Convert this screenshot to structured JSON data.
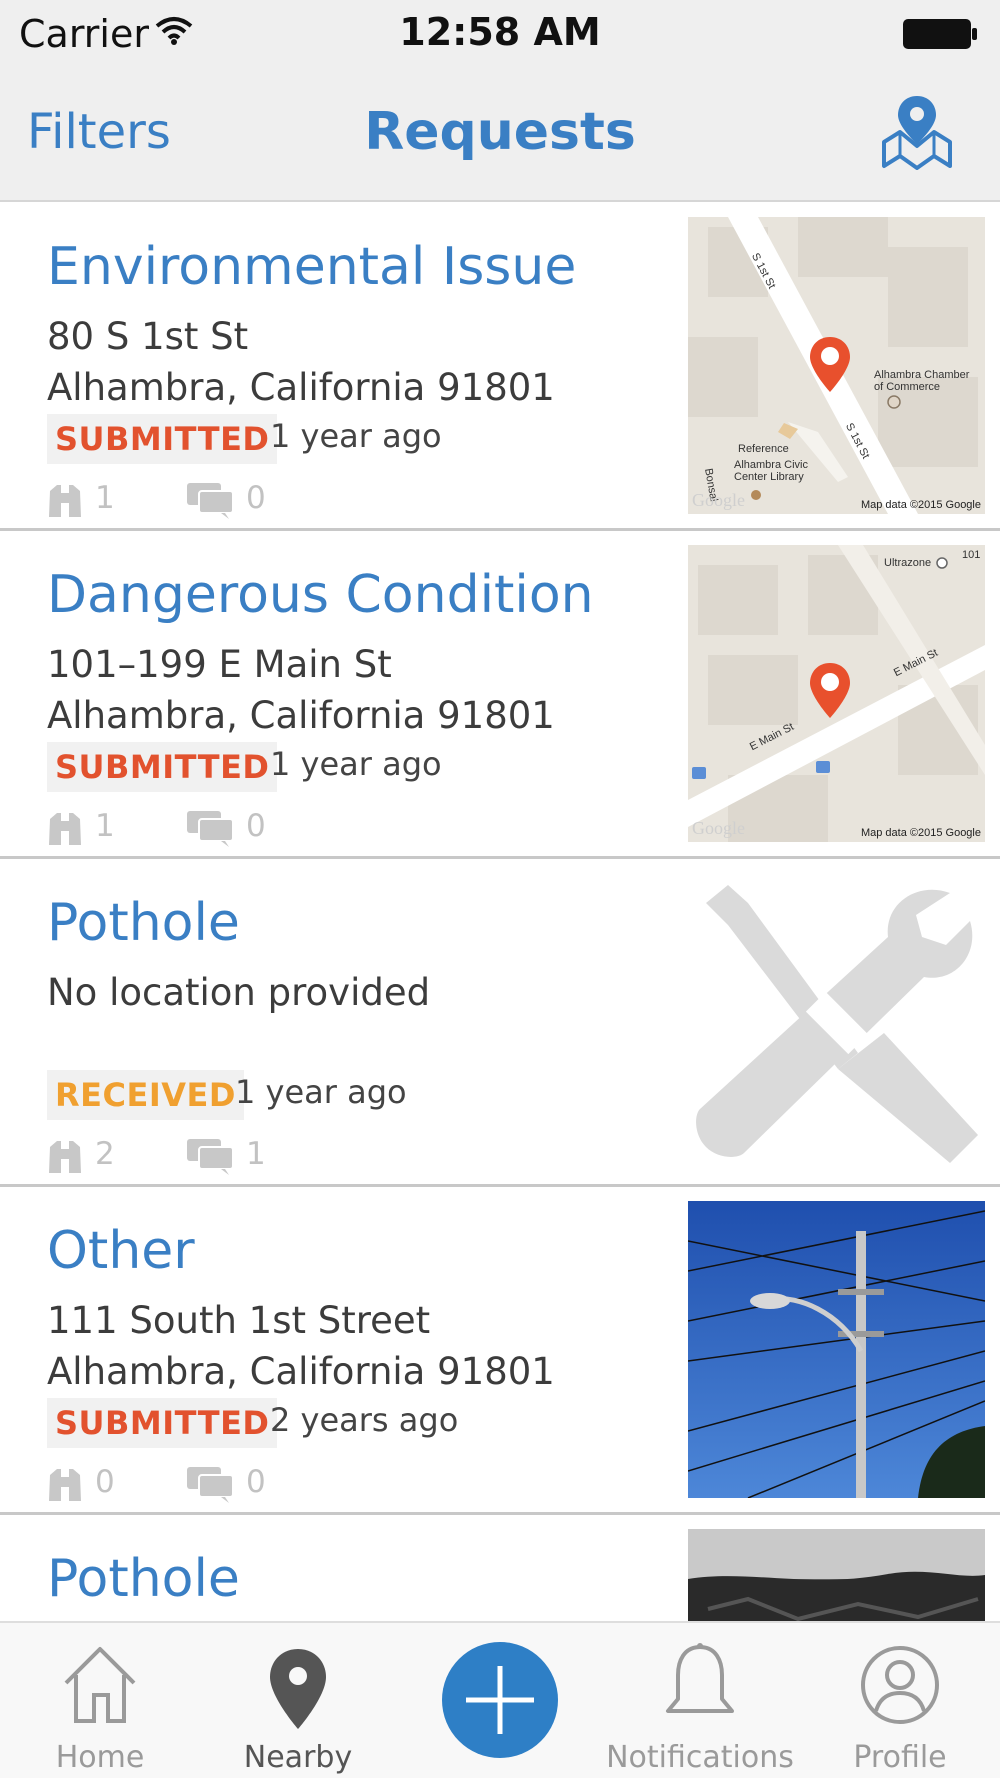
{
  "status_bar": {
    "carrier": "Carrier",
    "time": "12:58 AM"
  },
  "nav": {
    "left": "Filters",
    "title": "Requests",
    "map_icon": "map-pin-icon"
  },
  "requests": [
    {
      "title": "Environmental Issue",
      "line1": "80  S 1st St",
      "line2": "Alhambra, California 91801",
      "status": "SUBMITTED",
      "status_color": "#e2522e",
      "age": "1 year ago",
      "followers": "1",
      "comments": "0",
      "thumb": "map",
      "map": {
        "streets": [
          "S 1st St",
          "S 1st St"
        ],
        "labels": [
          "Alhambra Chamber",
          "of Commerce",
          "Reference",
          "Alhambra Civic",
          "Center Library",
          "Bonsal"
        ],
        "logo": "Google",
        "credit": "Map data ©2015 Google"
      }
    },
    {
      "title": "Dangerous Condition",
      "line1": "101–199  E Main St",
      "line2": "Alhambra, California 91801",
      "status": "SUBMITTED",
      "status_color": "#e2522e",
      "age": "1 year ago",
      "followers": "1",
      "comments": "0",
      "thumb": "map",
      "map": {
        "streets": [
          "E Main St",
          "E Main St"
        ],
        "labels": [
          "Ultrazone",
          "101"
        ],
        "logo": "Google",
        "credit": "Map data ©2015 Google"
      }
    },
    {
      "title": "Pothole",
      "line1": "No location provided",
      "line2": "",
      "status": "RECEIVED",
      "status_color": "#f0a030",
      "age": "1 year ago",
      "followers": "2",
      "comments": "1",
      "thumb": "tools-placeholder"
    },
    {
      "title": "Other",
      "line1": "111  South 1st Street",
      "line2": "Alhambra, California 91801",
      "status": "SUBMITTED",
      "status_color": "#e2522e",
      "age": "2 years ago",
      "followers": "0",
      "comments": "0",
      "thumb": "photo-streetlight"
    },
    {
      "title": "Pothole",
      "thumb": "photo-asphalt"
    }
  ],
  "tabs": [
    {
      "label": "Home",
      "icon": "home-icon"
    },
    {
      "label": "Nearby",
      "icon": "location-pin-icon",
      "active": true
    },
    {
      "label": "",
      "icon": "plus-icon"
    },
    {
      "label": "Notifications",
      "icon": "bell-icon"
    },
    {
      "label": "Profile",
      "icon": "user-icon"
    }
  ],
  "colors": {
    "accent": "#3a7fc4",
    "submitted": "#e2522e",
    "received": "#f0a030",
    "fab": "#2e7fc6"
  }
}
